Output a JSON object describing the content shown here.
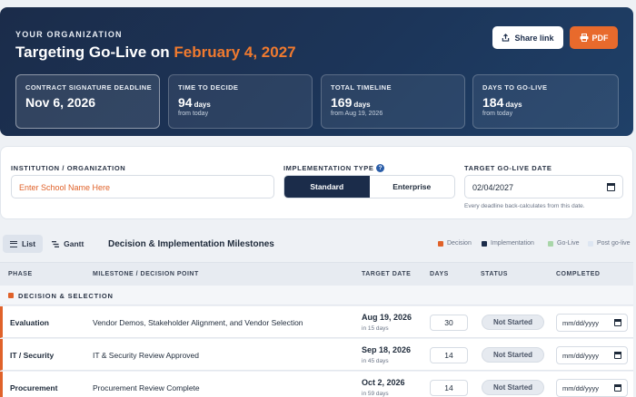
{
  "header": {
    "org_label": "YOUR ORGANIZATION",
    "title_prefix": "Targeting Go-Live on",
    "title_date": "February 4, 2027",
    "share_label": "Share link",
    "pdf_label": "PDF"
  },
  "stats": [
    {
      "label": "CONTRACT SIGNATURE DEADLINE",
      "value": "Nov 6, 2026",
      "unit": "",
      "sub": ""
    },
    {
      "label": "TIME TO DECIDE",
      "value": "94",
      "unit": "days",
      "sub": "from today"
    },
    {
      "label": "TOTAL TIMELINE",
      "value": "169",
      "unit": "days",
      "sub": "from Aug 19, 2026"
    },
    {
      "label": "DAYS TO GO-LIVE",
      "value": "184",
      "unit": "days",
      "sub": "from today"
    }
  ],
  "form": {
    "institution_label": "INSTITUTION / ORGANIZATION",
    "institution_placeholder": "Enter School Name Here",
    "impl_label": "IMPLEMENTATION TYPE",
    "impl_options": [
      "Standard",
      "Enterprise"
    ],
    "impl_selected": "Standard",
    "golive_label": "TARGET GO-LIVE DATE",
    "golive_value": "02/04/2027",
    "golive_hint": "Every deadline back-calculates from this date."
  },
  "milestones": {
    "view_list": "List",
    "view_gantt": "Gantt",
    "title": "Decision & Implementation Milestones",
    "legend": [
      {
        "label": "Decision",
        "color": "#e0622a"
      },
      {
        "label": "Implementation",
        "color": "#1b2c4a"
      },
      {
        "label": "Go-Live",
        "color": "#a9d6a9"
      },
      {
        "label": "Post go-live",
        "color": "#dde6f2"
      }
    ],
    "columns": [
      "PHASE",
      "MILESTONE / DECISION POINT",
      "TARGET DATE",
      "DAYS",
      "STATUS",
      "COMPLETED"
    ],
    "group": "DECISION & SELECTION",
    "rows": [
      {
        "phase": "Evaluation",
        "milestone": "Vendor Demos, Stakeholder Alignment, and Vendor Selection",
        "date": "Aug 19, 2026",
        "sub": "in 15 days",
        "days": "30",
        "status": "Not Started",
        "completed": "mm/dd/yyyy"
      },
      {
        "phase": "IT / Security",
        "milestone": "IT & Security Review Approved",
        "date": "Sep 18, 2026",
        "sub": "in 45 days",
        "days": "14",
        "status": "Not Started",
        "completed": "mm/dd/yyyy"
      },
      {
        "phase": "Procurement",
        "milestone": "Procurement Review Complete",
        "date": "Oct 2, 2026",
        "sub": "in 59 days",
        "days": "14",
        "status": "Not Started",
        "completed": "mm/dd/yyyy"
      }
    ]
  }
}
